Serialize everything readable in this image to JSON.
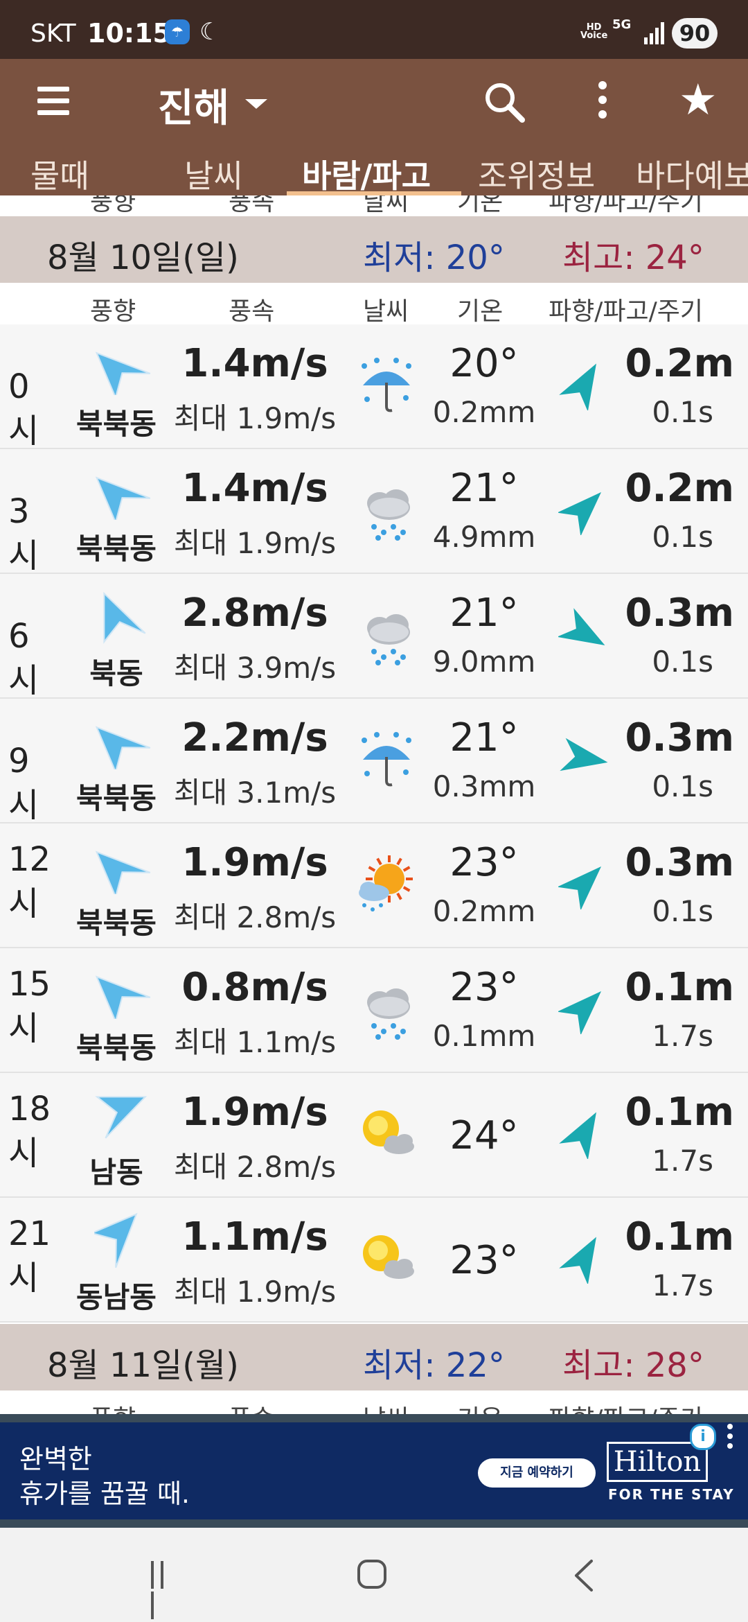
{
  "status_bar": {
    "carrier": "SKT",
    "time": "10:15",
    "hd_voice": "HD\nVoice",
    "network": "5G",
    "battery": "90",
    "icons": [
      "weather-app-icon",
      "moon-icon",
      "hd-voice-icon",
      "5g-icon",
      "signal-icon",
      "battery-icon"
    ]
  },
  "toolbar": {
    "title": "진해",
    "icons": [
      "menu-icon",
      "dropdown-caret-icon",
      "search-icon",
      "more-vert-icon",
      "star-icon"
    ]
  },
  "tabs": [
    {
      "label": "물때"
    },
    {
      "label": "날씨"
    },
    {
      "label": "바람/파고",
      "active": true
    },
    {
      "label": "조위정보"
    },
    {
      "label": "바다예보"
    }
  ],
  "column_headers": {
    "wind_dir": "풍향",
    "wind_speed": "풍속",
    "weather": "날씨",
    "temperature": "기온",
    "wave": "파향/파고/주기"
  },
  "days": [
    {
      "date": "8월 10일(일)",
      "min": "최저: 20°",
      "max": "최고: 24°",
      "rows": [
        {
          "hour": "0시",
          "wind_dir": "북북동",
          "wind_deg": 22,
          "speed": "1.4m/s",
          "gust": "최대 1.9m/s",
          "weather_icon": "rain-umbrella-icon",
          "temp": "20°",
          "rain": "0.2mm",
          "wave_deg": 30,
          "wave": "0.2m",
          "period": "0.1s"
        },
        {
          "hour": "3시",
          "wind_dir": "북북동",
          "wind_deg": 22,
          "speed": "1.4m/s",
          "gust": "최대 1.9m/s",
          "weather_icon": "cloud-rain-icon",
          "temp": "21°",
          "rain": "4.9mm",
          "wave_deg": 45,
          "wave": "0.2m",
          "period": "0.1s"
        },
        {
          "hour": "6시",
          "wind_dir": "북동",
          "wind_deg": 45,
          "speed": "2.8m/s",
          "gust": "최대 3.9m/s",
          "weather_icon": "cloud-rain-icon",
          "temp": "21°",
          "rain": "9.0mm",
          "wave_deg": 120,
          "wave": "0.3m",
          "period": "0.1s"
        },
        {
          "hour": "9시",
          "wind_dir": "북북동",
          "wind_deg": 22,
          "speed": "2.2m/s",
          "gust": "최대 3.1m/s",
          "weather_icon": "rain-umbrella-icon",
          "temp": "21°",
          "rain": "0.3mm",
          "wave_deg": 100,
          "wave": "0.3m",
          "period": "0.1s"
        },
        {
          "hour": "12시",
          "wind_dir": "북북동",
          "wind_deg": 22,
          "speed": "1.9m/s",
          "gust": "최대 2.8m/s",
          "weather_icon": "sun-cloud-rain-icon",
          "temp": "23°",
          "rain": "0.2mm",
          "wave_deg": 45,
          "wave": "0.3m",
          "period": "0.1s"
        },
        {
          "hour": "15시",
          "wind_dir": "북북동",
          "wind_deg": 22,
          "speed": "0.8m/s",
          "gust": "최대 1.1m/s",
          "weather_icon": "cloud-rain-icon",
          "temp": "23°",
          "rain": "0.1mm",
          "wave_deg": 45,
          "wave": "0.1m",
          "period": "1.7s"
        },
        {
          "hour": "18시",
          "wind_dir": "남동",
          "wind_deg": 135,
          "speed": "1.9m/s",
          "gust": "최대 2.8m/s",
          "weather_icon": "sun-cloud-icon",
          "temp": "24°",
          "rain": "",
          "wave_deg": 30,
          "wave": "0.1m",
          "period": "1.7s"
        },
        {
          "hour": "21시",
          "wind_dir": "동남동",
          "wind_deg": 112,
          "speed": "1.1m/s",
          "gust": "최대 1.9m/s",
          "weather_icon": "sun-cloud-icon",
          "temp": "23°",
          "rain": "",
          "wave_deg": 30,
          "wave": "0.1m",
          "period": "1.7s"
        }
      ]
    },
    {
      "date": "8월 11일(월)",
      "min": "최저: 22°",
      "max": "최고: 28°",
      "rows": []
    }
  ],
  "colors": {
    "status_bar": "#3d2a24",
    "toolbar": "#7a5240",
    "day_header": "#d6cbc6",
    "min_temp": "#1f3f99",
    "max_temp": "#9b2340",
    "wave_arrow": "#1aa9b0",
    "wind_arrow": "#59b8e8"
  },
  "ad": {
    "text_line1": "완벽한",
    "text_line2": "휴가를 꿈꿀 때.",
    "cta": "지금 예약하기",
    "brand": "Hilton",
    "tagline": "FOR THE STAY"
  },
  "nav_bar": {
    "icons": [
      "recent-apps-icon",
      "home-icon",
      "back-icon"
    ]
  }
}
